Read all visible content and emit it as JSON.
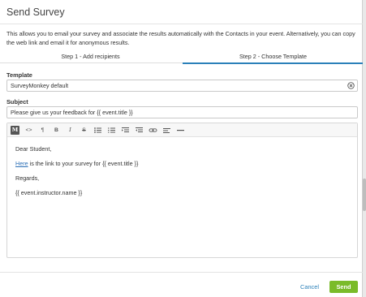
{
  "modal": {
    "title": "Send Survey",
    "intro": "This allows you to email your survey and associate the results automatically with the Contacts in your event. Alternatively, you can copy the web link and email it for anonymous results."
  },
  "tabs": [
    {
      "label": "Step 1 - Add recipients",
      "active": false
    },
    {
      "label": "Step 2 - Choose Template",
      "active": true
    }
  ],
  "form": {
    "template_label": "Template",
    "template_value": "SurveyMonkey default",
    "subject_label": "Subject",
    "subject_value": "Please give us your feedback for {{ event.title }}"
  },
  "toolbar": {
    "markdown_label": "M",
    "code_label": "<>",
    "paragraph_label": "¶",
    "bold_label": "B",
    "italic_label": "I",
    "strike_label": "S",
    "icons": [
      "markdown-icon",
      "code-icon",
      "paragraph-icon",
      "bold-icon",
      "italic-icon",
      "strikethrough-icon",
      "bullet-list-icon",
      "numbered-list-icon",
      "indent-icon",
      "outdent-icon",
      "link-icon",
      "align-icon",
      "horizontal-rule-icon"
    ]
  },
  "body": {
    "greeting": "Dear Student,",
    "link_text": "Here",
    "link_rest": " is the link to your survey for {{ event.title }}",
    "regards": "Regards,",
    "signature": "{{ event.instructor.name }}"
  },
  "footer": {
    "cancel_label": "Cancel",
    "send_label": "Send"
  },
  "colors": {
    "accent": "#2b80b9",
    "send": "#7abb2a"
  }
}
